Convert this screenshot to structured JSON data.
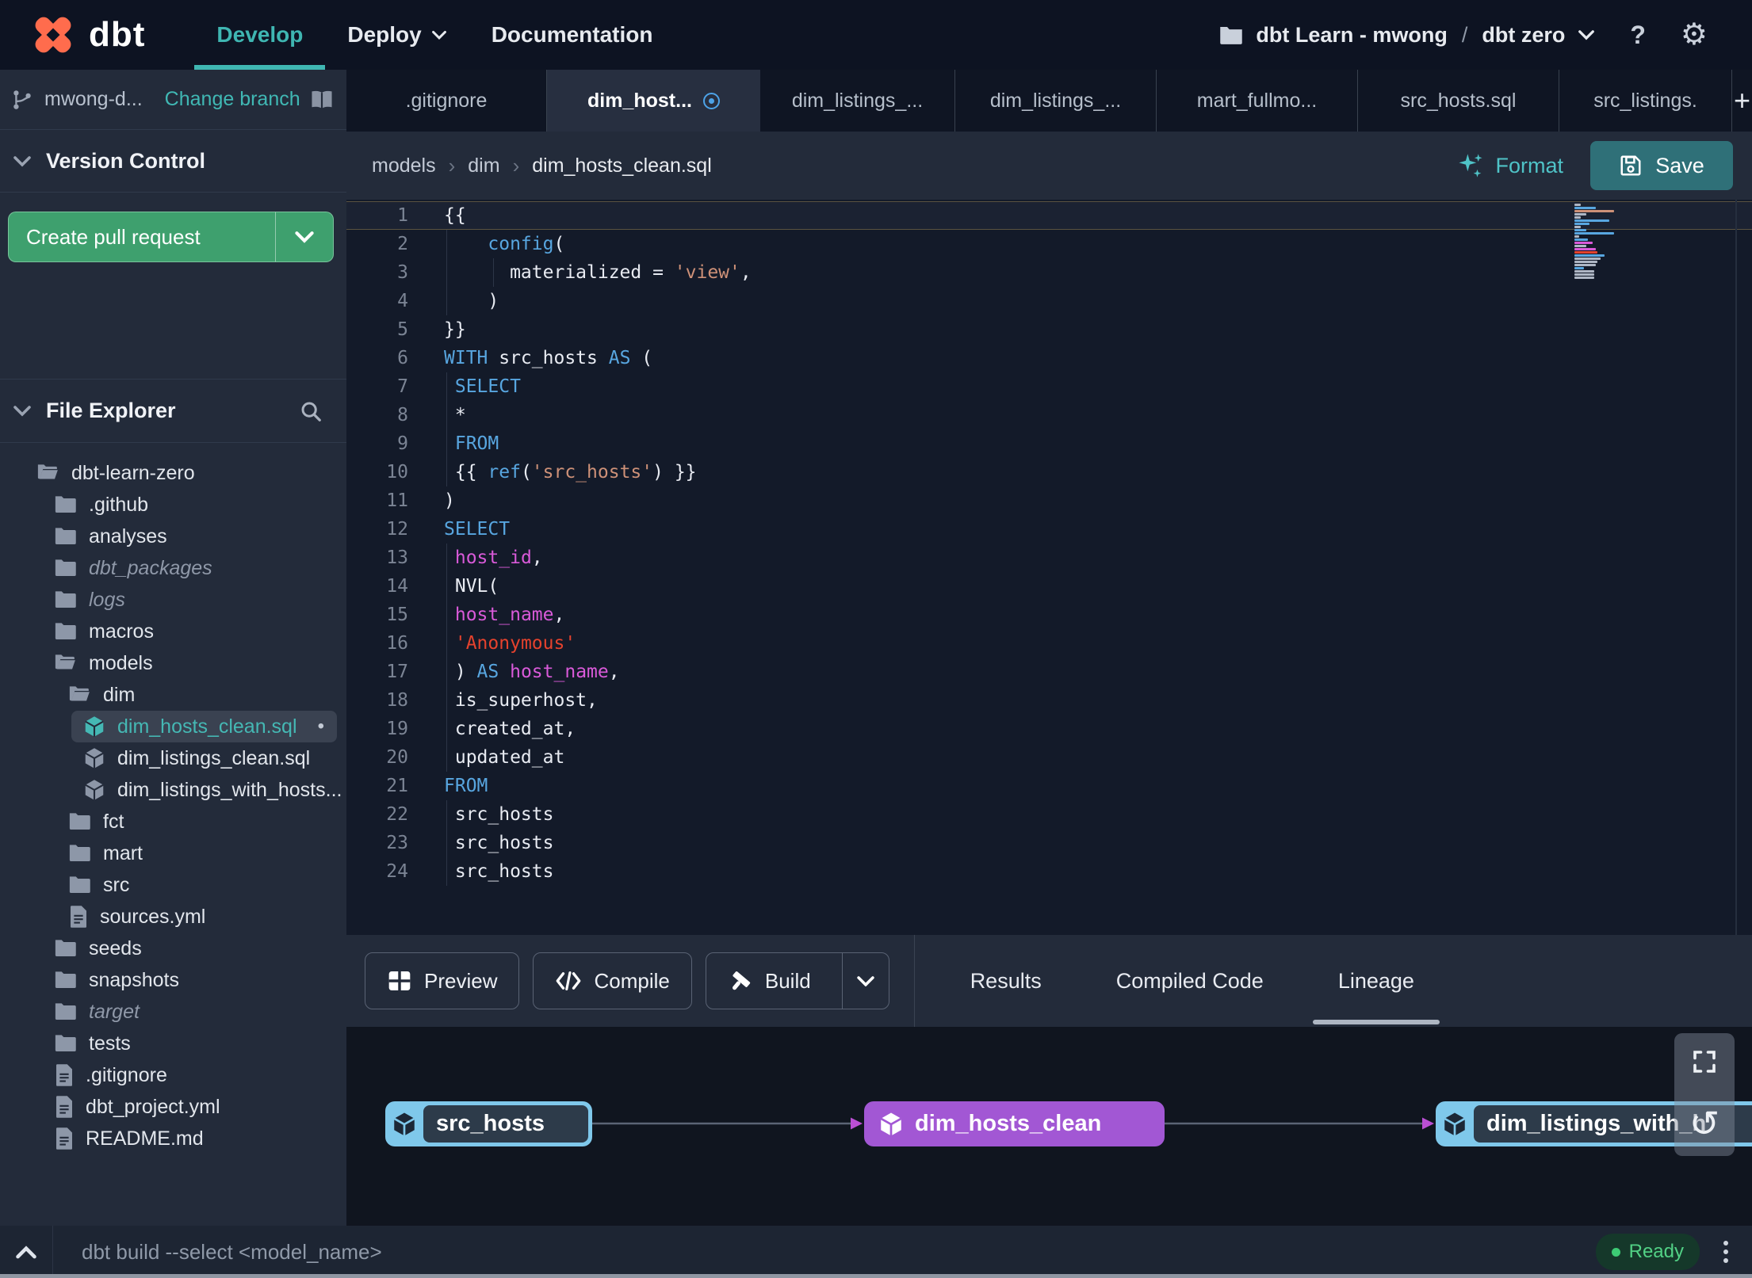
{
  "navbar": {
    "logo_text": "dbt",
    "items": [
      {
        "label": "Develop",
        "active": true,
        "chevron": false
      },
      {
        "label": "Deploy",
        "active": false,
        "chevron": true
      },
      {
        "label": "Documentation",
        "active": false,
        "chevron": false
      }
    ],
    "project": {
      "account": "dbt Learn - mwong",
      "separator": "/",
      "name": "dbt zero"
    },
    "help_label": "?"
  },
  "sidebar": {
    "branch": {
      "name": "mwong-d...",
      "action": "Change branch"
    },
    "version_control": {
      "title": "Version Control",
      "button": "Create pull request"
    },
    "file_explorer": {
      "title": "File Explorer",
      "tree": [
        {
          "label": "dbt-learn-zero",
          "type": "folder-open",
          "level": 0
        },
        {
          "label": ".github",
          "type": "folder",
          "level": 1
        },
        {
          "label": "analyses",
          "type": "folder",
          "level": 1
        },
        {
          "label": "dbt_packages",
          "type": "folder",
          "level": 1,
          "italic": true
        },
        {
          "label": "logs",
          "type": "folder",
          "level": 1,
          "italic": true
        },
        {
          "label": "macros",
          "type": "folder",
          "level": 1
        },
        {
          "label": "models",
          "type": "folder-open",
          "level": 1
        },
        {
          "label": "dim",
          "type": "folder-open",
          "level": 2
        },
        {
          "label": "dim_hosts_clean.sql",
          "type": "model",
          "level": 3,
          "selected": true,
          "modified": true
        },
        {
          "label": "dim_listings_clean.sql",
          "type": "model",
          "level": 3
        },
        {
          "label": "dim_listings_with_hosts...",
          "type": "model",
          "level": 3
        },
        {
          "label": "fct",
          "type": "folder",
          "level": 2
        },
        {
          "label": "mart",
          "type": "folder",
          "level": 2
        },
        {
          "label": "src",
          "type": "folder",
          "level": 2
        },
        {
          "label": "sources.yml",
          "type": "file",
          "level": 2
        },
        {
          "label": "seeds",
          "type": "folder",
          "level": 1
        },
        {
          "label": "snapshots",
          "type": "folder",
          "level": 1
        },
        {
          "label": "target",
          "type": "folder",
          "level": 1,
          "italic": true
        },
        {
          "label": "tests",
          "type": "folder",
          "level": 1
        },
        {
          "label": ".gitignore",
          "type": "file",
          "level": 1
        },
        {
          "label": "dbt_project.yml",
          "type": "file",
          "level": 1
        },
        {
          "label": "README.md",
          "type": "file",
          "level": 1
        }
      ]
    }
  },
  "tabs": {
    "items": [
      {
        "label": ".gitignore"
      },
      {
        "label": "dim_host...",
        "active": true,
        "modified": true
      },
      {
        "label": "dim_listings_..."
      },
      {
        "label": "dim_listings_..."
      },
      {
        "label": "mart_fullmo..."
      },
      {
        "label": "src_hosts.sql"
      },
      {
        "label": "src_listings."
      }
    ],
    "add_button": "+"
  },
  "editor": {
    "breadcrumb": [
      "models",
      "dim",
      "dim_hosts_clean.sql"
    ],
    "format_label": "Format",
    "save_label": "Save",
    "code": {
      "lines": [
        {
          "num": 1,
          "current": true,
          "guides": [],
          "tokens": [
            [
              "{{",
              "fg"
            ]
          ]
        },
        {
          "num": 2,
          "guides": [
            3
          ],
          "tokens": [
            [
              "    ",
              "fg"
            ],
            [
              "config",
              "kw"
            ],
            [
              "(",
              "fg"
            ]
          ]
        },
        {
          "num": 3,
          "guides": [
            3,
            62
          ],
          "tokens": [
            [
              "      materialized = ",
              "fg"
            ],
            [
              "'view'",
              "str"
            ],
            [
              ",",
              "fg"
            ]
          ]
        },
        {
          "num": 4,
          "guides": [
            3
          ],
          "tokens": [
            [
              "    )",
              "fg"
            ]
          ]
        },
        {
          "num": 5,
          "guides": [],
          "tokens": [
            [
              "}}",
              "fg"
            ]
          ]
        },
        {
          "num": 6,
          "guides": [],
          "tokens": [
            [
              "WITH",
              "kw"
            ],
            [
              " src_hosts ",
              "fg"
            ],
            [
              "AS",
              "kw"
            ],
            [
              " (",
              "fg"
            ]
          ]
        },
        {
          "num": 7,
          "guides": [
            3
          ],
          "tokens": [
            [
              " ",
              "fg"
            ],
            [
              "SELECT",
              "kw"
            ]
          ]
        },
        {
          "num": 8,
          "guides": [
            3
          ],
          "tokens": [
            [
              " *",
              "fg"
            ]
          ]
        },
        {
          "num": 9,
          "guides": [
            3
          ],
          "tokens": [
            [
              " ",
              "fg"
            ],
            [
              "FROM",
              "kw"
            ]
          ]
        },
        {
          "num": 10,
          "guides": [
            3
          ],
          "tokens": [
            [
              " {{ ",
              "fg"
            ],
            [
              "ref",
              "kw"
            ],
            [
              "(",
              "fg"
            ],
            [
              "'src_hosts'",
              "str"
            ],
            [
              ")",
              "fg"
            ],
            [
              " }}",
              "fg"
            ]
          ]
        },
        {
          "num": 11,
          "guides": [],
          "tokens": [
            [
              ")",
              "fg"
            ]
          ]
        },
        {
          "num": 12,
          "guides": [],
          "tokens": [
            [
              "SELECT",
              "kw"
            ]
          ]
        },
        {
          "num": 13,
          "guides": [
            3
          ],
          "tokens": [
            [
              " ",
              "fg"
            ],
            [
              "host_id",
              "id"
            ],
            [
              ",",
              "fg"
            ]
          ]
        },
        {
          "num": 14,
          "guides": [
            3
          ],
          "tokens": [
            [
              " NVL(",
              "fg"
            ]
          ]
        },
        {
          "num": 15,
          "guides": [
            3
          ],
          "tokens": [
            [
              " ",
              "fg"
            ],
            [
              "host_name",
              "id"
            ],
            [
              ",",
              "fg"
            ]
          ]
        },
        {
          "num": 16,
          "guides": [
            3
          ],
          "tokens": [
            [
              " ",
              "fg"
            ],
            [
              "'Anonymous'",
              "red"
            ]
          ]
        },
        {
          "num": 17,
          "guides": [
            3
          ],
          "tokens": [
            [
              " ) ",
              "fg"
            ],
            [
              "AS",
              "kw"
            ],
            [
              " ",
              "fg"
            ],
            [
              "host_name",
              "id"
            ],
            [
              ",",
              "fg"
            ]
          ]
        },
        {
          "num": 18,
          "guides": [
            3
          ],
          "tokens": [
            [
              " is_superhost,",
              "fg"
            ]
          ]
        },
        {
          "num": 19,
          "guides": [
            3
          ],
          "tokens": [
            [
              " created_at,",
              "fg"
            ]
          ]
        },
        {
          "num": 20,
          "guides": [
            3
          ],
          "tokens": [
            [
              " updated_at",
              "fg"
            ]
          ]
        },
        {
          "num": 21,
          "guides": [],
          "tokens": [
            [
              "FROM",
              "kw"
            ]
          ]
        },
        {
          "num": 22,
          "guides": [
            3
          ],
          "tokens": [
            [
              " src_hosts",
              "fg"
            ]
          ]
        },
        {
          "num": 23,
          "guides": [
            3
          ],
          "tokens": [
            [
              " src_hosts",
              "fg"
            ]
          ]
        },
        {
          "num": 24,
          "guides": [
            3
          ],
          "tokens": [
            [
              " src_hosts",
              "fg"
            ]
          ]
        }
      ]
    }
  },
  "panel": {
    "actions": [
      {
        "label": "Preview",
        "icon": "grid-icon"
      },
      {
        "label": "Compile",
        "icon": "code-icon"
      },
      {
        "label": "Build",
        "icon": "hammer-icon",
        "split": true
      }
    ],
    "tabs": [
      {
        "label": "Results"
      },
      {
        "label": "Compiled Code"
      },
      {
        "label": "Lineage",
        "active": true
      }
    ]
  },
  "lineage": {
    "nodes": [
      {
        "label": "src_hosts",
        "kind": "source"
      },
      {
        "label": "dim_hosts_clean",
        "kind": "model"
      },
      {
        "label": "dim_listings_with_h",
        "kind": "source"
      }
    ]
  },
  "statusbar": {
    "command_placeholder": "dbt build --select <model_name>",
    "status": "Ready"
  },
  "icons": {
    "settings": "⚙",
    "help": "?",
    "refresh": "↺",
    "add_tab": "+",
    "modified_dot": "•"
  },
  "colors": {
    "accent_teal": "#3fb6b2",
    "green_button": "#3ea06e",
    "save_button": "#2f7078",
    "node_source_blue": "#7fc8eb",
    "node_model_purple": "#a257d4",
    "syntax_keyword": "#58a6e0",
    "syntax_identifier": "#d95ad9",
    "syntax_string": "#ce9178",
    "syntax_error_string": "#e5422d",
    "status_ready_green": "#3dcb74",
    "modified_blue": "#4da3e8",
    "logo_orange": "#ff6c4d"
  }
}
